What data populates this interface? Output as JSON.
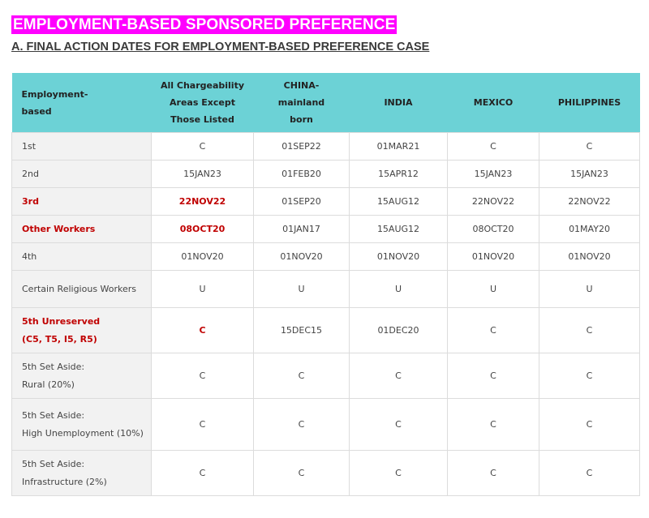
{
  "page_title": "EMPLOYMENT-BASED SPONSORED PREFERENCE",
  "section_title": "A. FINAL ACTION DATES FOR EMPLOYMENT-BASED PREFERENCE CASE",
  "colors": {
    "title_bg": "#ff00ff",
    "header_bg": "#6cd2d6",
    "highlight_text": "#c00000",
    "category_cell_bg": "#f2f2f2"
  },
  "table": {
    "headers": [
      [
        "Employment-",
        "based"
      ],
      [
        "All Chargeability",
        "Areas Except",
        "Those Listed"
      ],
      [
        "CHINA-",
        "mainland",
        "born"
      ],
      [
        "INDIA"
      ],
      [
        "MEXICO"
      ],
      [
        "PHILIPPINES"
      ]
    ],
    "rows": [
      {
        "category": [
          "1st"
        ],
        "highlight": false,
        "values": [
          "C",
          "01SEP22",
          "01MAR21",
          "C",
          "C"
        ]
      },
      {
        "category": [
          "2nd"
        ],
        "highlight": false,
        "values": [
          "15JAN23",
          "01FEB20",
          "15APR12",
          "15JAN23",
          "15JAN23"
        ]
      },
      {
        "category": [
          "3rd"
        ],
        "highlight": true,
        "values": [
          "22NOV22",
          "01SEP20",
          "15AUG12",
          "22NOV22",
          "22NOV22"
        ]
      },
      {
        "category": [
          "Other Workers"
        ],
        "highlight": true,
        "values": [
          "08OCT20",
          "01JAN17",
          "15AUG12",
          "08OCT20",
          "01MAY20"
        ]
      },
      {
        "category": [
          "4th"
        ],
        "highlight": false,
        "values": [
          "01NOV20",
          "01NOV20",
          "01NOV20",
          "01NOV20",
          "01NOV20"
        ]
      },
      {
        "category": [
          "Certain Religious Workers"
        ],
        "highlight": false,
        "values": [
          "U",
          "U",
          "U",
          "U",
          "U"
        ]
      },
      {
        "category": [
          "5th Unreserved",
          "(C5, T5, I5, R5)"
        ],
        "highlight": true,
        "values": [
          "C",
          "15DEC15",
          "01DEC20",
          "C",
          "C"
        ]
      },
      {
        "category": [
          "5th Set Aside:",
          "Rural (20%)"
        ],
        "highlight": false,
        "values": [
          "C",
          "C",
          "C",
          "C",
          "C"
        ]
      },
      {
        "category": [
          "5th Set Aside:",
          "High Unemployment (10%)"
        ],
        "highlight": false,
        "values": [
          "C",
          "C",
          "C",
          "C",
          "C"
        ]
      },
      {
        "category": [
          "5th Set Aside:",
          "Infrastructure  (2%)"
        ],
        "highlight": false,
        "values": [
          "C",
          "C",
          "C",
          "C",
          "C"
        ]
      }
    ]
  }
}
